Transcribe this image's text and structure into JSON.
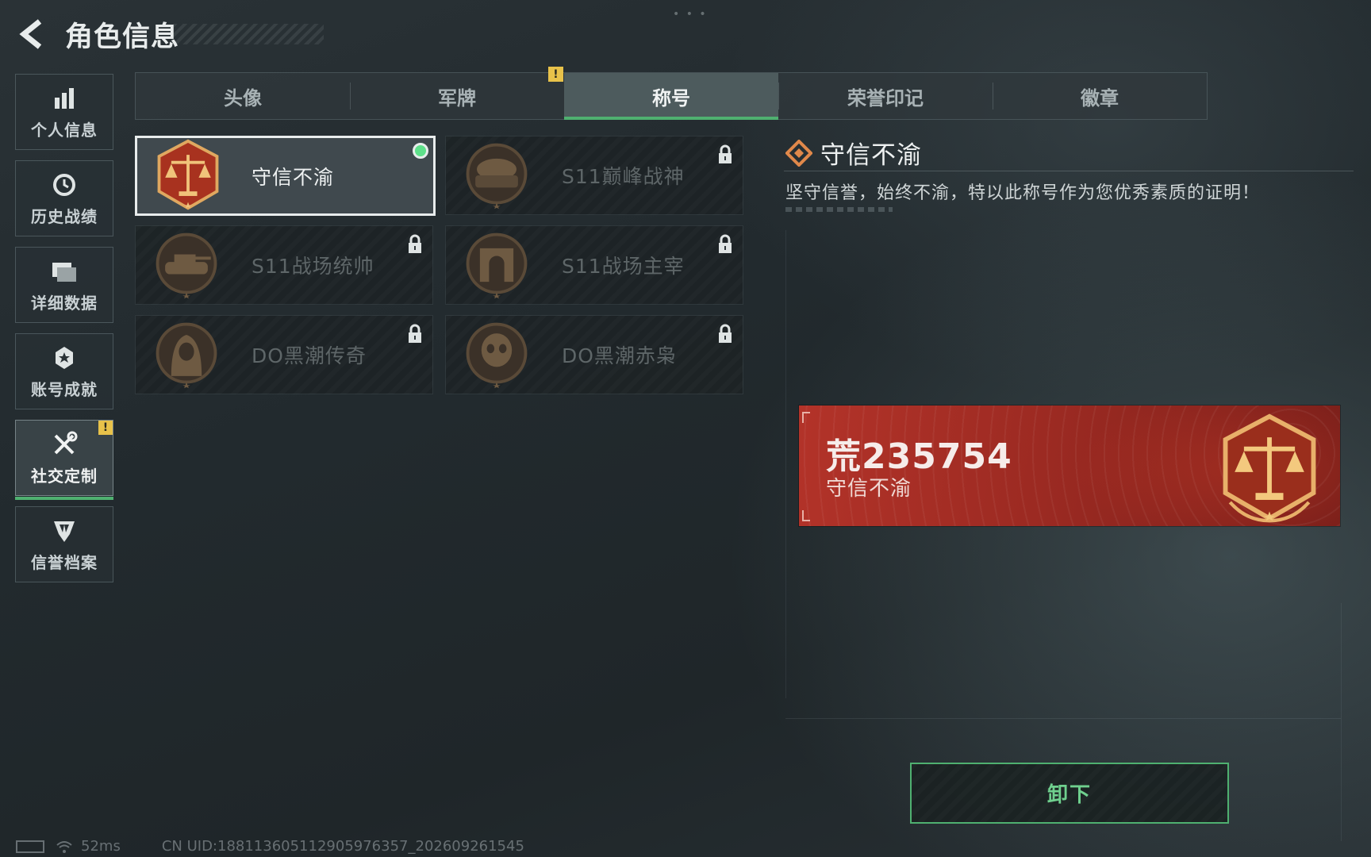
{
  "header": {
    "title": "角色信息",
    "back_icon": "chevron-left-icon"
  },
  "sidebar": {
    "items": [
      {
        "label": "个人信息",
        "icon": "bar-chart-icon",
        "active": false
      },
      {
        "label": "历史战绩",
        "icon": "history-clock-icon",
        "active": false
      },
      {
        "label": "详细数据",
        "icon": "folder-icon",
        "active": false
      },
      {
        "label": "账号成就",
        "icon": "achievement-medal-icon",
        "active": false
      },
      {
        "label": "社交定制",
        "icon": "tools-icon",
        "active": true,
        "alert": "!"
      },
      {
        "label": "信誉档案",
        "icon": "credit-shield-icon",
        "active": false
      }
    ]
  },
  "tabs": {
    "items": [
      {
        "label": "头像",
        "active": false
      },
      {
        "label": "军牌",
        "active": false,
        "alert": "!"
      },
      {
        "label": "称号",
        "active": true
      },
      {
        "label": "荣誉印记",
        "active": false
      },
      {
        "label": "徽章",
        "active": false
      }
    ]
  },
  "titles": [
    {
      "name": "守信不渝",
      "emblem": "scales-of-justice-emblem",
      "selected": true,
      "equipped": true,
      "locked": false
    },
    {
      "name": "S11巅峰战神",
      "emblem": "helmet-emblem",
      "selected": false,
      "equipped": false,
      "locked": true
    },
    {
      "name": "S11战场统帅",
      "emblem": "tank-emblem",
      "selected": false,
      "equipped": false,
      "locked": true
    },
    {
      "name": "S11战场主宰",
      "emblem": "arch-emblem",
      "selected": false,
      "equipped": false,
      "locked": true
    },
    {
      "name": "DO黑潮传奇",
      "emblem": "hooded-figure-emblem",
      "selected": false,
      "equipped": false,
      "locked": true
    },
    {
      "name": "DO黑潮赤枭",
      "emblem": "skull-mask-emblem",
      "selected": false,
      "equipped": false,
      "locked": true
    }
  ],
  "detail": {
    "title": "守信不渝",
    "description": "坚守信誉，始终不渝，特以此称号作为您优秀素质的证明！"
  },
  "preview": {
    "player_name": "荒235754",
    "title": "守信不渝"
  },
  "action": {
    "label": "卸下"
  },
  "footer": {
    "ping": "52ms",
    "uid": "CN UID:18811360511290597635​7_202609261545"
  },
  "colors": {
    "accent_green": "#4fb070",
    "alert_yellow": "#e8c24a",
    "nameplate_red": "#b33329",
    "emblem_gold": "#d9a45a"
  }
}
